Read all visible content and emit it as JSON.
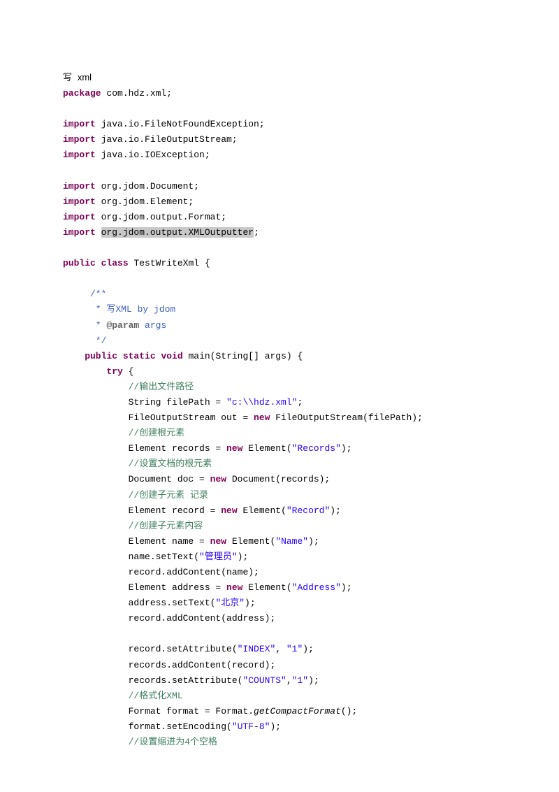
{
  "code": {
    "l01a": "写 ",
    "l01b": "xml",
    "l02a": "package",
    "l02b": " com.hdz.xml;",
    "l04a": "import",
    "l04b": " java.io.FileNotFoundException;",
    "l05a": "import",
    "l05b": " java.io.FileOutputStream;",
    "l06a": "import",
    "l06b": " java.io.IOException;",
    "l08a": "import",
    "l08b": " org.jdom.Document;",
    "l09a": "import",
    "l09b": " org.jdom.Element;",
    "l10a": "import",
    "l10b": " org.jdom.output.Format;",
    "l11a": "import",
    "l11b": " ",
    "l11c": "org.jdom.output.XMLOutputter",
    "l11d": ";",
    "l13a": "public",
    "l13b": " ",
    "l13c": "class",
    "l13d": " TestWriteXml {",
    "l15": "     /**",
    "l16": "      * 写XML by jdom",
    "l17a": "      * ",
    "l17b": "@param",
    "l17c": " args",
    "l18": "      */",
    "l19a": "    public",
    "l19b": " ",
    "l19c": "static",
    "l19d": " ",
    "l19e": "void",
    "l19f": " main(String[] args) {",
    "l20a": "        try",
    "l20b": " {",
    "l21": "            //输出文件路径",
    "l22a": "            String filePath = ",
    "l22b": "\"c:\\\\hdz.xml\"",
    "l22c": ";",
    "l23a": "            FileOutputStream out = ",
    "l23b": "new",
    "l23c": " FileOutputStream(filePath);",
    "l24": "            //创建根元素",
    "l25a": "            Element records = ",
    "l25b": "new",
    "l25c": " Element(",
    "l25d": "\"Records\"",
    "l25e": ");",
    "l26": "            //设置文档的根元素",
    "l27a": "            Document doc = ",
    "l27b": "new",
    "l27c": " Document(records);",
    "l28": "            //创建子元素 记录",
    "l29a": "            Element record = ",
    "l29b": "new",
    "l29c": " Element(",
    "l29d": "\"Record\"",
    "l29e": ");",
    "l30": "            //创建子元素内容",
    "l31a": "            Element name = ",
    "l31b": "new",
    "l31c": " Element(",
    "l31d": "\"Name\"",
    "l31e": ");",
    "l32a": "            name.setText(",
    "l32b": "\"管理员\"",
    "l32c": ");",
    "l33": "            record.addContent(name);",
    "l34a": "            Element address = ",
    "l34b": "new",
    "l34c": " Element(",
    "l34d": "\"Address\"",
    "l34e": ");",
    "l35a": "            address.setText(",
    "l35b": "\"北京\"",
    "l35c": ");",
    "l36": "            record.addContent(address);",
    "l38a": "            record.setAttribute(",
    "l38b": "\"INDEX\"",
    "l38c": ", ",
    "l38d": "\"1\"",
    "l38e": ");",
    "l39": "            records.addContent(record);",
    "l40a": "            records.setAttribute(",
    "l40b": "\"COUNTS\"",
    "l40c": ",",
    "l40d": "\"1\"",
    "l40e": ");",
    "l41": "            //格式化XML",
    "l42a": "            Format format = Format.",
    "l42b": "getCompactFormat",
    "l42c": "();",
    "l43a": "            format.setEncoding(",
    "l43b": "\"UTF-8\"",
    "l43c": ");",
    "l44": "            //设置缩进为4个空格"
  }
}
